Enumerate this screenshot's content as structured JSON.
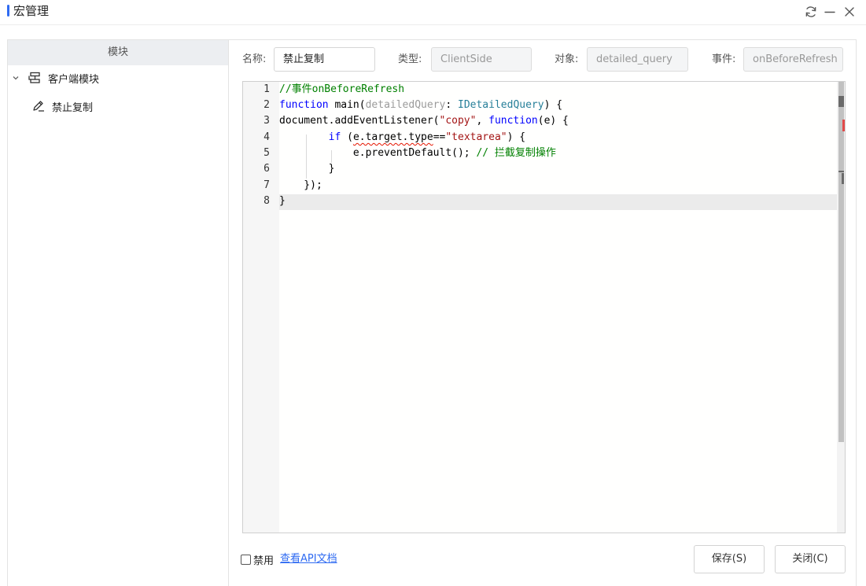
{
  "window": {
    "title": "宏管理",
    "accent_color": "#2f6bf2",
    "controls": [
      "refresh-icon",
      "minimize-icon",
      "close-icon"
    ]
  },
  "sidebar": {
    "header": "模块",
    "tree": [
      {
        "label": "客户端模块",
        "icon": "module-icon",
        "expanded": true
      },
      {
        "label": "禁止复制",
        "icon": "edit-pen-icon"
      }
    ]
  },
  "form": {
    "name_label": "名称:",
    "name_value": "禁止复制",
    "type_label": "类型:",
    "type_value": "ClientSide",
    "object_label": "对象:",
    "object_value": "detailed_query",
    "event_label": "事件:",
    "event_value": "onBeforeRefresh"
  },
  "editor": {
    "line_numbers": [
      "1",
      "2",
      "3",
      "4",
      "5",
      "6",
      "7",
      "8"
    ],
    "lines": [
      "//事件onBeforeRefresh",
      "function main(detailedQuery: IDetailedQuery) {",
      "document.addEventListener(\"copy\", function(e) {",
      "        if (e.target.type==\"textarea\") {",
      "            e.preventDefault(); // 拦截复制操作",
      "        }",
      "    });",
      "}"
    ]
  },
  "footer": {
    "disable_label": "禁用",
    "api_link": "查看API文档",
    "save_button": "保存(S)",
    "close_button": "关闭(C)"
  }
}
